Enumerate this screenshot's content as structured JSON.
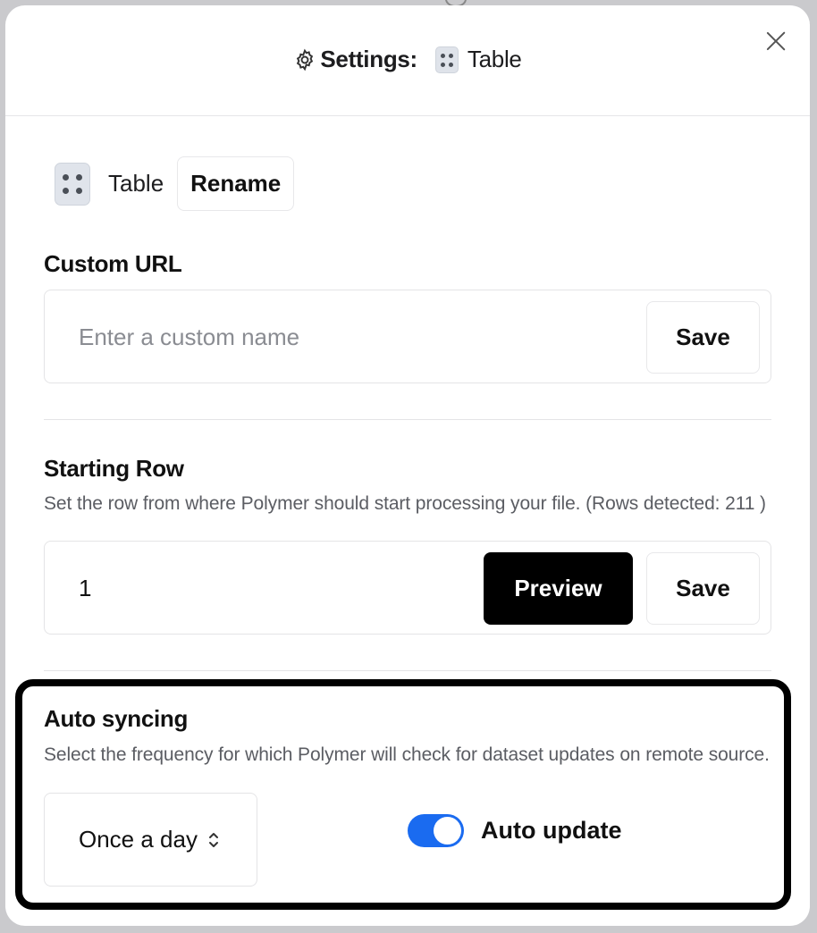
{
  "header": {
    "title": "Settings:",
    "table_name": "Table"
  },
  "table": {
    "name": "Table",
    "rename_label": "Rename"
  },
  "custom_url": {
    "title": "Custom URL",
    "placeholder": "Enter a custom name",
    "value": "",
    "save_label": "Save"
  },
  "starting_row": {
    "title": "Starting Row",
    "description": "Set the row from where Polymer should start processing your file. (Rows detected: 211 )",
    "value": "1",
    "preview_label": "Preview",
    "save_label": "Save"
  },
  "auto_syncing": {
    "title": "Auto syncing",
    "description": "Select the frequency for which Polymer will check for dataset updates on remote source.",
    "frequency": "Once a day",
    "auto_update_label": "Auto update",
    "auto_update_on": true
  },
  "colors": {
    "toggle_on": "#1a6bf0",
    "primary_button": "#000000"
  },
  "icons": [
    "settings-gear-icon",
    "table-icon",
    "close-icon",
    "chevron-up-down-icon"
  ]
}
